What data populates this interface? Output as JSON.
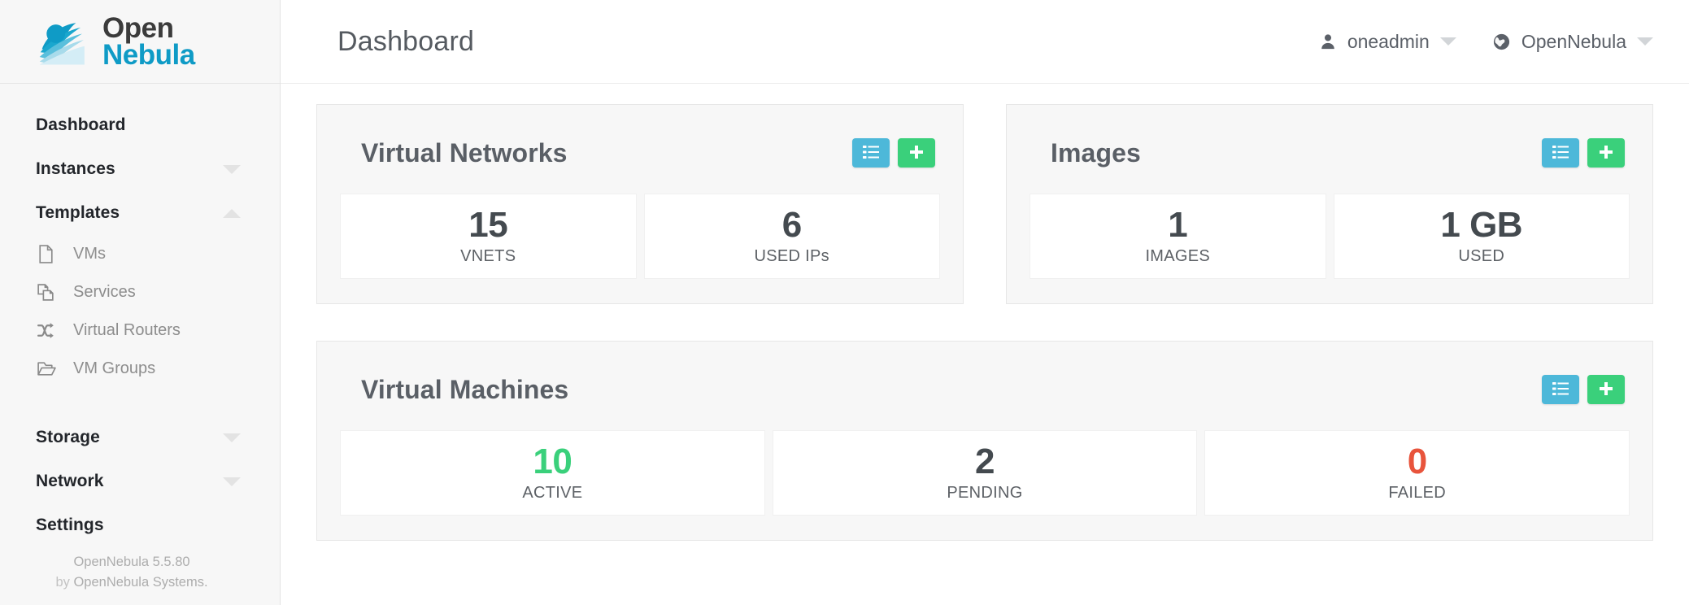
{
  "brand": {
    "logo_line1": "Open",
    "logo_line2": "Nebula",
    "logo_icon": "opennebula-logo-icon",
    "color_primary": "#0f9bc6",
    "color_blue_button": "#4db8d9",
    "color_green_button": "#3ad07b",
    "color_green_stat": "#3ad07b",
    "color_red_stat": "#e8543c"
  },
  "sidebar": {
    "items": [
      {
        "label": "Dashboard",
        "type": "group",
        "icon": null,
        "caret": null
      },
      {
        "label": "Instances",
        "type": "group",
        "icon": null,
        "caret": "chevron-down-icon"
      },
      {
        "label": "Templates",
        "type": "group",
        "icon": null,
        "caret": "chevron-up-icon"
      },
      {
        "label": "VMs",
        "type": "sub",
        "icon": "document-icon"
      },
      {
        "label": "Services",
        "type": "sub",
        "icon": "copy-pages-icon"
      },
      {
        "label": "Virtual Routers",
        "type": "sub",
        "icon": "shuffle-icon"
      },
      {
        "label": "VM Groups",
        "type": "sub",
        "icon": "folder-open-icon"
      },
      {
        "label": "Storage",
        "type": "group",
        "icon": null,
        "caret": "chevron-down-icon"
      },
      {
        "label": "Network",
        "type": "group",
        "icon": null,
        "caret": "chevron-down-icon"
      },
      {
        "label": "Settings",
        "type": "group",
        "icon": null,
        "caret": null
      }
    ],
    "footer": {
      "version": "OpenNebula 5.5.80",
      "by_prefix": "by",
      "by_company": "OpenNebula Systems."
    }
  },
  "header": {
    "title": "Dashboard",
    "user": {
      "label": "oneadmin",
      "icon": "user-icon",
      "caret": "chevron-down-icon"
    },
    "zone": {
      "label": "OpenNebula",
      "icon": "globe-icon",
      "caret": "chevron-down-icon"
    }
  },
  "cards": [
    {
      "title": "Virtual Networks",
      "actions": [
        {
          "icon": "list-icon",
          "style": "blue"
        },
        {
          "icon": "plus-icon",
          "style": "green"
        }
      ],
      "tiles": [
        {
          "value": "15",
          "label": "VNETS",
          "color": "default"
        },
        {
          "value": "6",
          "label": "USED IPs",
          "color": "default"
        }
      ]
    },
    {
      "title": "Images",
      "actions": [
        {
          "icon": "list-icon",
          "style": "blue"
        },
        {
          "icon": "plus-icon",
          "style": "green"
        }
      ],
      "tiles": [
        {
          "value": "1",
          "label": "IMAGES",
          "color": "default"
        },
        {
          "value": "1 GB",
          "label": "USED",
          "color": "default"
        }
      ]
    },
    {
      "title": "Virtual Machines",
      "actions": [
        {
          "icon": "list-icon",
          "style": "blue"
        },
        {
          "icon": "plus-icon",
          "style": "green"
        }
      ],
      "tiles": [
        {
          "value": "10",
          "label": "ACTIVE",
          "color": "green"
        },
        {
          "value": "2",
          "label": "PENDING",
          "color": "default"
        },
        {
          "value": "0",
          "label": "FAILED",
          "color": "red"
        }
      ]
    }
  ]
}
